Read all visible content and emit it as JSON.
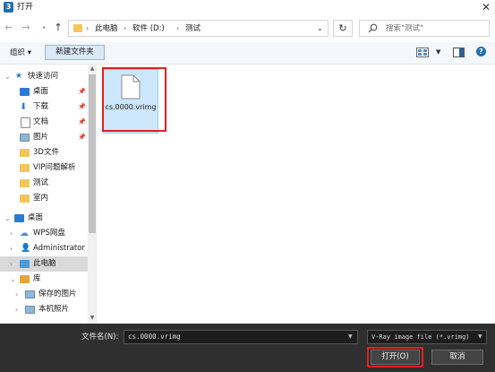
{
  "window": {
    "title": "打开",
    "app_icon_letter": "3"
  },
  "address": {
    "crumbs": [
      "此电脑",
      "软件 (D:)",
      "测试"
    ]
  },
  "search": {
    "placeholder": "搜索\"测试\""
  },
  "toolbar": {
    "organize": "组织 ▾",
    "new_folder": "新建文件夹"
  },
  "nav": {
    "items": [
      {
        "label": "快速访问",
        "icon": "star-icon"
      },
      {
        "label": "桌面",
        "icon": "desktop-icon",
        "pinned": true
      },
      {
        "label": "下载",
        "icon": "download-icon",
        "pinned": true
      },
      {
        "label": "文档",
        "icon": "document-icon",
        "pinned": true
      },
      {
        "label": "图片",
        "icon": "picture-icon",
        "pinned": true
      },
      {
        "label": "3D文件",
        "icon": "folder-icon"
      },
      {
        "label": "VIP问题解析",
        "icon": "folder-icon"
      },
      {
        "label": "测试",
        "icon": "folder-icon"
      },
      {
        "label": "室内",
        "icon": "folder-icon"
      },
      {
        "label": "桌面",
        "icon": "desktop-icon"
      },
      {
        "label": "WPS网盘",
        "icon": "cloud-icon"
      },
      {
        "label": "Administrator",
        "icon": "user-icon"
      },
      {
        "label": "此电脑",
        "icon": "computer-icon",
        "selected": true
      },
      {
        "label": "库",
        "icon": "library-icon"
      },
      {
        "label": "保存的图片",
        "icon": "picture-icon"
      },
      {
        "label": "本机照片",
        "icon": "picture-icon"
      }
    ]
  },
  "files": [
    {
      "name": "cs.0000.vrimg",
      "icon": "file-icon",
      "selected": true
    }
  ],
  "bottom": {
    "filename_label": "文件名(N):",
    "filename_value": "cs.0000.vrimg",
    "filetype_value": "V-Ray image file (*.vrimg)",
    "open_label": "打开(O)",
    "cancel_label": "取消"
  },
  "colors": {
    "accent": "#1f6fb0",
    "highlight_box": "#e02020",
    "selection": "#cce6fa",
    "bottom_panel": "#2f2f2f"
  }
}
